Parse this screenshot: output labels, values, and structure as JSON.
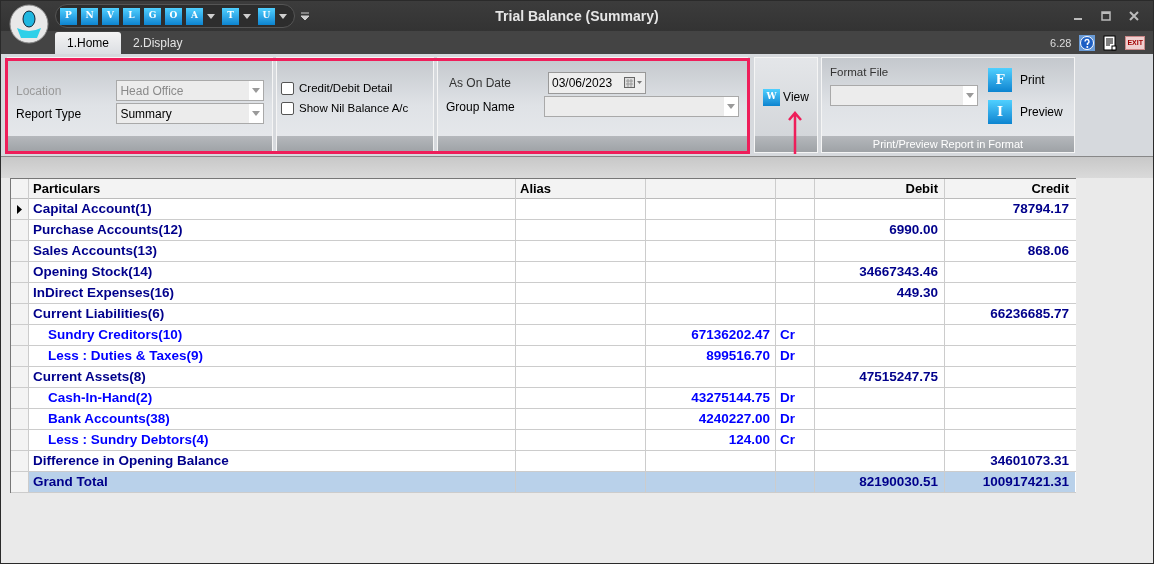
{
  "window": {
    "title": "Trial Balance (Summary)"
  },
  "quick_access": [
    {
      "letter": "P",
      "has_menu": false
    },
    {
      "letter": "N",
      "has_menu": false
    },
    {
      "letter": "V",
      "has_menu": false
    },
    {
      "letter": "L",
      "has_menu": false
    },
    {
      "letter": "G",
      "has_menu": false
    },
    {
      "letter": "O",
      "has_menu": false
    },
    {
      "letter": "A",
      "has_menu": true
    },
    {
      "letter": "T",
      "has_menu": true
    },
    {
      "letter": "U",
      "has_menu": true
    }
  ],
  "tabs": [
    {
      "label": "1.Home",
      "selected": true
    },
    {
      "label": "2.Display",
      "selected": false
    }
  ],
  "version": "6.28",
  "exit_label": "EXIT",
  "ribbon": {
    "location": {
      "label": "Location",
      "value": "Head Office",
      "disabled": true
    },
    "report_type": {
      "label": "Report Type",
      "value": "Summary",
      "disabled": false
    },
    "checkboxes": [
      {
        "label": "Credit/Debit Detail",
        "checked": false
      },
      {
        "label": "Show Nil Balance A/c",
        "checked": false
      }
    ],
    "as_on_date": {
      "label": "As On Date",
      "value": "03/06/2023"
    },
    "group_name": {
      "label": "Group Name"
    },
    "view": {
      "icon_letter": "W",
      "label": "View"
    },
    "format_file": {
      "label": "Format File"
    },
    "print": {
      "icon_letter": "F",
      "label": "Print"
    },
    "preview": {
      "icon_letter": "I",
      "label": "Preview"
    },
    "format_group_caption": "Print/Preview Report in Format"
  },
  "table": {
    "columns": {
      "particulars": "Particulars",
      "alias": "Alias",
      "debit": "Debit",
      "credit": "Credit"
    },
    "rows": [
      {
        "kind": "account",
        "current": true,
        "particulars": "Capital Account(1)",
        "credit": "78794.17"
      },
      {
        "kind": "account",
        "current": false,
        "particulars": "Purchase Accounts(12)",
        "debit": "6990.00"
      },
      {
        "kind": "account",
        "current": false,
        "particulars": "Sales Accounts(13)",
        "credit": "868.06"
      },
      {
        "kind": "account",
        "current": false,
        "particulars": "Opening Stock(14)",
        "debit": "34667343.46"
      },
      {
        "kind": "account",
        "current": false,
        "particulars": "InDirect Expenses(16)",
        "debit": "449.30"
      },
      {
        "kind": "account",
        "current": false,
        "particulars": "Current Liabilities(6)",
        "credit": "66236685.77",
        "children": [
          {
            "particulars": "Sundry Creditors(10)",
            "amount": "67136202.47",
            "dr_cr": "Cr"
          },
          {
            "particulars": "Less : Duties & Taxes(9)",
            "amount": "899516.70",
            "dr_cr": "Dr"
          }
        ]
      },
      {
        "kind": "account",
        "current": false,
        "particulars": "Current Assets(8)",
        "debit": "47515247.75",
        "children": [
          {
            "particulars": "Cash-In-Hand(2)",
            "amount": "43275144.75",
            "dr_cr": "Dr"
          },
          {
            "particulars": "Bank Accounts(38)",
            "amount": "4240227.00",
            "dr_cr": "Dr"
          },
          {
            "particulars": "Less : Sundry Debtors(4)",
            "amount": "124.00",
            "dr_cr": "Cr"
          }
        ]
      },
      {
        "kind": "account",
        "current": false,
        "particulars": "Difference in Opening Balance",
        "credit": "34601073.31"
      },
      {
        "kind": "total",
        "current": false,
        "particulars": "Grand Total",
        "debit": "82190030.51",
        "credit": "100917421.31"
      }
    ]
  }
}
